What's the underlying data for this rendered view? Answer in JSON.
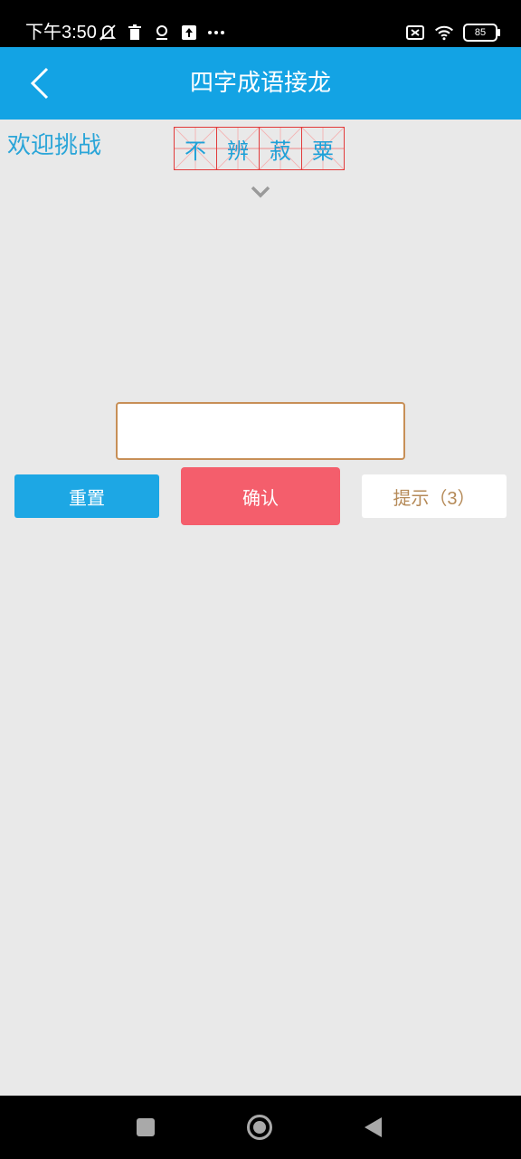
{
  "status_bar": {
    "time": "下午3:50",
    "battery": "85",
    "icons_left": [
      "mute-icon",
      "trash-icon",
      "location-icon",
      "upload-icon",
      "more-icon"
    ],
    "icons_right": [
      "sim-off-icon",
      "wifi-icon",
      "battery-icon"
    ]
  },
  "app_bar": {
    "title": "四字成语接龙",
    "background": "#13a3e4"
  },
  "game": {
    "welcome_text": "欢迎挑战",
    "idiom_chars": [
      "不",
      "辨",
      "菽",
      "粟"
    ],
    "answer_input_value": "",
    "answer_input_placeholder": ""
  },
  "buttons": {
    "reset_label": "重置",
    "confirm_label": "确认",
    "hint_label": "提示（3）"
  },
  "colors": {
    "accent_blue": "#13a3e4",
    "confirm_red": "#f45e6c",
    "grid_red": "#e23b3b",
    "hint_brown": "#b58a58",
    "background": "#e9e9e9"
  },
  "nav_bar": {
    "icons": [
      "recent-apps-icon",
      "home-icon",
      "back-nav-icon"
    ]
  }
}
